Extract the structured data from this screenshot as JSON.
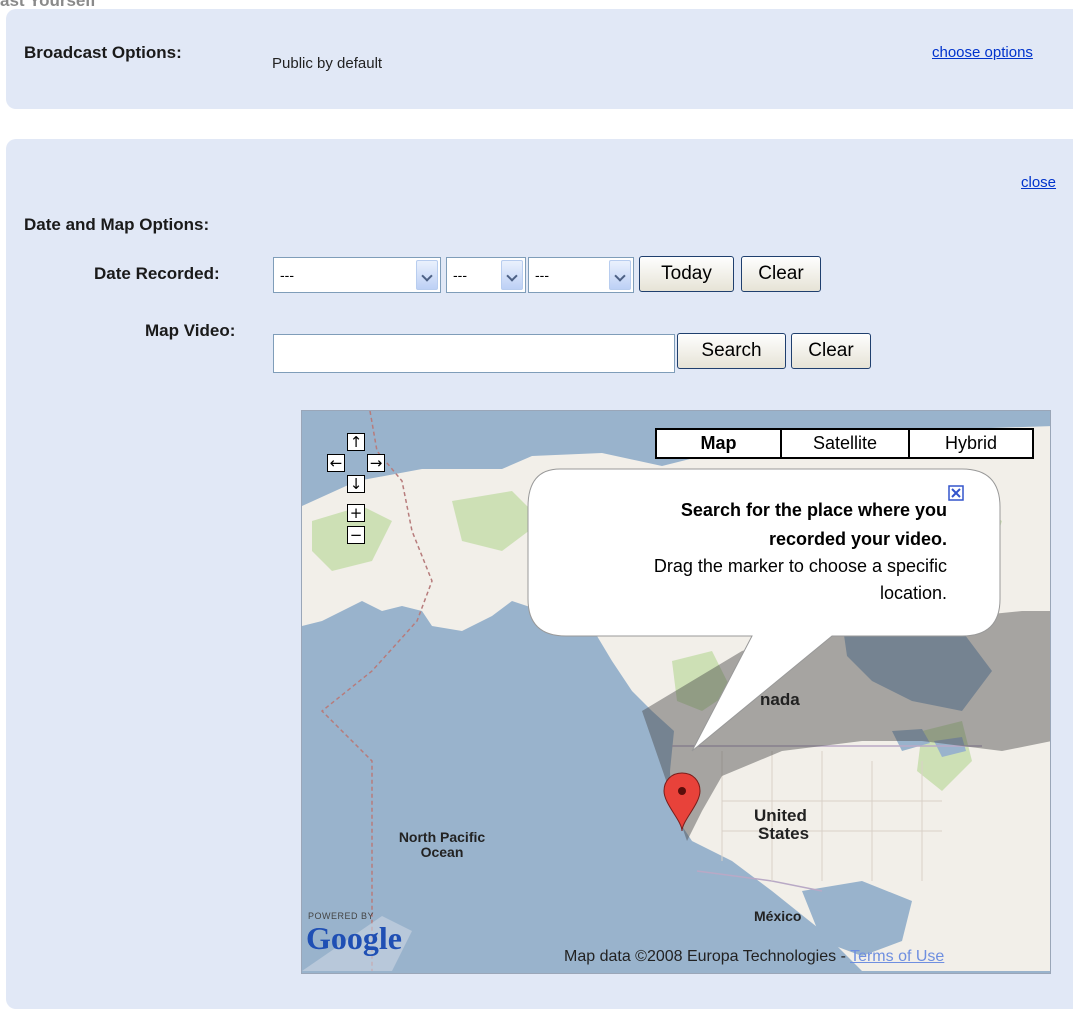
{
  "top_cut_text": "ast Yourself",
  "broadcast": {
    "label": "Broadcast Options:",
    "value": "Public by default",
    "link": "choose options"
  },
  "date_map": {
    "close_link": "close",
    "heading": "Date and Map Options:",
    "date_label": "Date Recorded:",
    "month_value": "---",
    "day_value": "---",
    "year_value": "---",
    "today_button": "Today",
    "clear_date_button": "Clear",
    "map_label": "Map Video:",
    "location_value": "",
    "search_button": "Search",
    "clear_map_button": "Clear"
  },
  "map": {
    "types": [
      "Map",
      "Satellite",
      "Hybrid"
    ],
    "selected_type": "Map",
    "controls": {
      "up": "↑",
      "left": "←",
      "right": "→",
      "down": "↓",
      "zoom_in": "+",
      "zoom_out": "−"
    },
    "bubble": {
      "line1": "Search for the place where you",
      "line2": "recorded your video.",
      "line3": "Drag the marker to choose a specific",
      "line4": "location."
    },
    "labels": {
      "canada": "nada",
      "us1": "United",
      "us2": "States",
      "ocean1": "North Pacific",
      "ocean2": "Ocean",
      "mexico": "México"
    },
    "powered_by": "POWERED BY",
    "google": "Google",
    "attribution": "Map data ©2008 Europa Technologies - ",
    "terms": "Terms of Use",
    "colors": {
      "water": "#99b3cc",
      "land": "#f2efe9",
      "forest": "#cde0b5",
      "marker": "#e8423a"
    }
  }
}
